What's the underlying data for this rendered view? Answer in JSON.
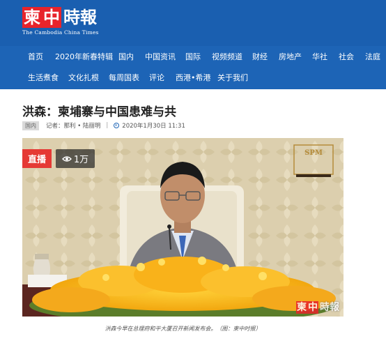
{
  "site": {
    "logo_chars": [
      "柬",
      "中",
      "時",
      "報"
    ],
    "logo_subtitle": "The Cambodia China Times"
  },
  "nav": {
    "row1": [
      "首页",
      "2020年新春特辑",
      "国内",
      "中国资讯",
      "国际",
      "视频频道",
      "财经",
      "房地产",
      "华社",
      "社会",
      "法庭"
    ],
    "row2": [
      "生活煮食",
      "文化扎根",
      "每周国表",
      "评论",
      "西港•希港",
      "关于我们"
    ]
  },
  "article": {
    "title": "洪森：柬埔寨与中国患难与共",
    "tag": "国内",
    "author": "记者：那利 • 陆丽明",
    "date": "2020年1月30日 11:31"
  },
  "video": {
    "live_label": "直播",
    "views": "1万",
    "broadcaster_logo": "SPM",
    "watermark_chars": [
      "柬",
      "中",
      "時",
      "報"
    ]
  },
  "caption": "洪森今早在总理府和平大厦召开新闻发布会。（图：柬中时报）",
  "colors": {
    "header_blue": "#1a5fb0",
    "nav_blue": "#1d64b6",
    "logo_red": "#e8242b",
    "live_red": "#e53935"
  }
}
